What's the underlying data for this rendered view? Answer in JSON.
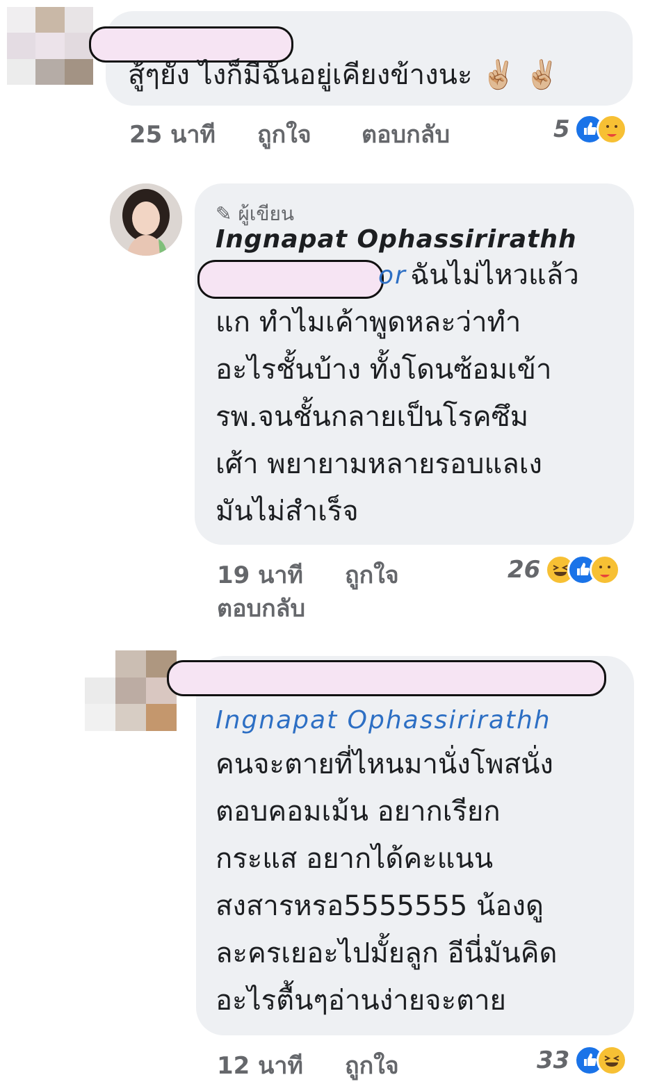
{
  "comment1": {
    "text": "สู้ๆยัง ไงก็มีฉันอยู่เคียงข้างนะ ✌🏼 ✌🏼",
    "time": "25 นาที",
    "like_label": "ถูกใจ",
    "reply_label": "ตอบกลับ",
    "reaction_count": "5"
  },
  "comment2": {
    "author_tag": "ผู้เขียน",
    "author": "Ingnapat Ophassirirathh",
    "mention_tail": "or",
    "text": "ฉันไม่ไหวแล้ว\nแก ทำไมเค้าพูดหละว่าทำ\nอะไรชั้นบ้าง ทั้งโดนซ้อมเข้า\nรพ.จนชั้นกลายเป็นโรคซึม\nเศ้า พยายามหลายรอบแลเง\nมันไม่สำเร็จ",
    "time": "19 นาที",
    "like_label": "ถูกใจ",
    "reply_label": "ตอบกลับ",
    "reaction_count": "26"
  },
  "comment3": {
    "mention": "Ingnapat Ophassirirathh",
    "text": "คนจะตายที่ไหนมานั่งโพสนั่ง\nตอบคอมเม้น อยากเรียก\nกระแส อยากได้คะแนน\nสงสารหรอ5555555 น้องดู\nละครเยอะไปมั้ยลูก อีนี่มันคิด\nอะไรตื้นๆอ่านง่ายจะตาย",
    "time": "12 นาที",
    "like_label": "ถูกใจ",
    "reaction_count": "33"
  },
  "colors": {
    "bubble": "#eef0f3",
    "mention": "#2d6fc4",
    "like": "#1a73e8",
    "meta": "#65676b"
  }
}
